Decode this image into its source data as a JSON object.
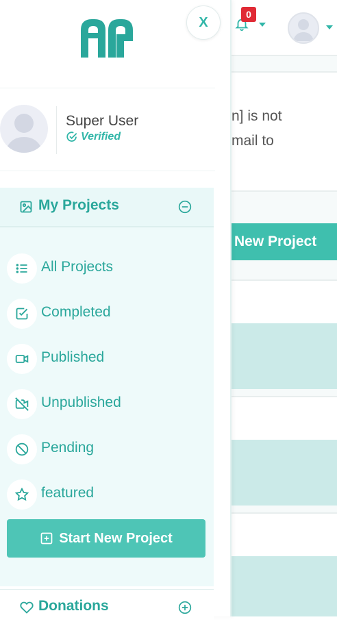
{
  "header": {
    "notification_count": "0",
    "close_label": "X"
  },
  "background": {
    "alert_line_1": "n] is not",
    "alert_line_2": "mail to",
    "new_project_label": "New Project"
  },
  "profile": {
    "name": "Super User",
    "status": "Verified"
  },
  "projects_section": {
    "title": "My Projects",
    "items": [
      {
        "label": "All Projects",
        "icon": "list-icon"
      },
      {
        "label": "Completed",
        "icon": "checkbox-icon"
      },
      {
        "label": "Published",
        "icon": "video-icon"
      },
      {
        "label": "Unpublished",
        "icon": "video-off-icon"
      },
      {
        "label": "Pending",
        "icon": "ban-icon"
      },
      {
        "label": "featured",
        "icon": "star-icon"
      }
    ],
    "start_button_label": "Start New Project"
  },
  "donations_section": {
    "title": "Donations"
  },
  "colors": {
    "accent": "#2aa79b",
    "button": "#4ec5b6",
    "badge": "#e02a35",
    "panel_bg": "#eefafa"
  }
}
